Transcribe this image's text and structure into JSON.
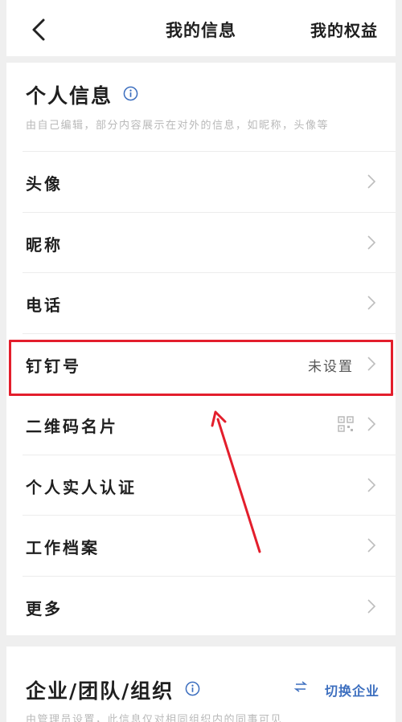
{
  "header": {
    "title": "我的信息",
    "right_action": "我的权益"
  },
  "personal": {
    "title": "个人信息",
    "description": "由自己编辑，部分内容展示在对外的信息，如昵称，头像等",
    "rows": [
      {
        "label": "头像",
        "value": ""
      },
      {
        "label": "昵称",
        "value": ""
      },
      {
        "label": "电话",
        "value": ""
      },
      {
        "label": "钉钉号",
        "value": "未设置"
      },
      {
        "label": "二维码名片",
        "value": ""
      },
      {
        "label": "个人实人认证",
        "value": ""
      },
      {
        "label": "工作档案",
        "value": ""
      },
      {
        "label": "更多",
        "value": ""
      }
    ]
  },
  "org": {
    "title": "企业/团队/组织",
    "switch_label": "切换企业",
    "description": "由管理员设置，此信息仅对相同组织内的同事可见"
  },
  "colors": {
    "accent": "#3d6fbf",
    "highlight": "#e31e2c"
  }
}
